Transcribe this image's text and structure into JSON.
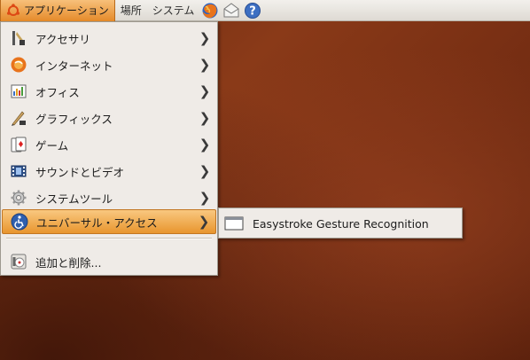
{
  "panel": {
    "menus": [
      {
        "label": "アプリケーション"
      },
      {
        "label": "場所"
      },
      {
        "label": "システム"
      }
    ],
    "launchers": [
      {
        "icon": "firefox-icon"
      },
      {
        "icon": "mail-icon"
      },
      {
        "icon": "help-icon"
      }
    ]
  },
  "applications_menu": {
    "items": [
      {
        "label": "アクセサリ",
        "icon": "accessories-icon",
        "has_submenu": true
      },
      {
        "label": "インターネット",
        "icon": "internet-icon",
        "has_submenu": true
      },
      {
        "label": "オフィス",
        "icon": "office-icon",
        "has_submenu": true
      },
      {
        "label": "グラフィックス",
        "icon": "graphics-icon",
        "has_submenu": true
      },
      {
        "label": "ゲーム",
        "icon": "games-icon",
        "has_submenu": true
      },
      {
        "label": "サウンドとビデオ",
        "icon": "sound-video-icon",
        "has_submenu": true
      },
      {
        "label": "システムツール",
        "icon": "system-tools-icon",
        "has_submenu": true
      },
      {
        "label": "ユニバーサル・アクセス",
        "icon": "universal-access-icon",
        "has_submenu": true,
        "highlighted": true
      }
    ],
    "footer_item": {
      "label": "追加と削除...",
      "icon": "add-remove-icon"
    },
    "arrow_glyph": "❯"
  },
  "universal_access_submenu": {
    "items": [
      {
        "label": "Easystroke Gesture Recognition",
        "icon": "window-icon"
      }
    ]
  },
  "colors": {
    "highlight": "#e8952e",
    "menu_bg": "#efebe7",
    "desktop": "#7a3014"
  }
}
